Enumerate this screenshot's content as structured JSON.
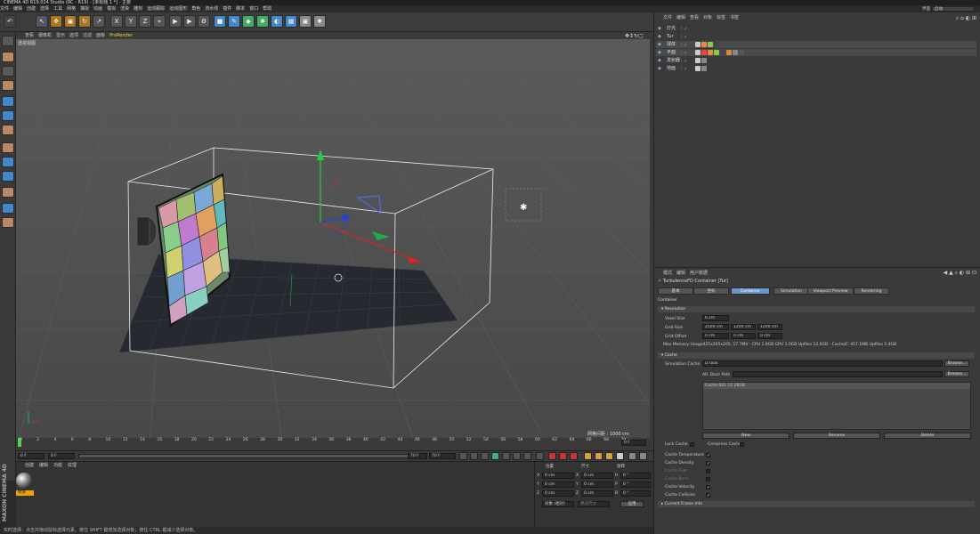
{
  "window": {
    "title": "CINEMA 4D R19.024 Studio (RC - R19) - [未标题 1 *] - 主要"
  },
  "menubar": [
    "文件",
    "编辑",
    "创建",
    "选择",
    "工具",
    "网格",
    "捕捉",
    "动画",
    "模拟",
    "渲染",
    "雕刻",
    "运动跟踪",
    "运动图形",
    "角色",
    "流水线",
    "插件",
    "脚本",
    "窗口",
    "帮助"
  ],
  "toolbar": {
    "icons": [
      "undo-icon",
      "move-icon",
      "scale-icon",
      "rotate-icon",
      "select-icon",
      "x-axis-icon",
      "y-axis-icon",
      "z-axis-icon",
      "coord-icon",
      "render-view-icon",
      "render-icon",
      "render-settings-icon",
      "cube-icon",
      "pen-icon",
      "subdivision-icon",
      "cloner-icon",
      "deformer-icon",
      "floor-icon",
      "camera-icon",
      "light-icon"
    ],
    "xyz": [
      "X",
      "Y",
      "Z"
    ]
  },
  "viewport": {
    "menu": [
      "查看",
      "摄像机",
      "显示",
      "选项",
      "过滤",
      "面板",
      "ProRender"
    ],
    "label": "透视视图",
    "grid_scale_label": "网格间距 : 1000 cm"
  },
  "timeline": {
    "ticks": [
      "0",
      "2",
      "4",
      "6",
      "8",
      "10",
      "12",
      "14",
      "16",
      "18",
      "20",
      "22",
      "24",
      "26",
      "28",
      "30",
      "32",
      "34",
      "36",
      "38",
      "40",
      "42",
      "44",
      "46",
      "48",
      "50",
      "52",
      "54",
      "56",
      "58",
      "60",
      "62",
      "64",
      "66",
      "68",
      "70"
    ],
    "end_label": "0 F"
  },
  "transport": {
    "current": "0 F",
    "start": "0 F",
    "end": "70 F",
    "end2": "70 F"
  },
  "material": {
    "menu": [
      "创建",
      "编辑",
      "功能",
      "纹理"
    ],
    "name": "材质"
  },
  "coords": {
    "headers": [
      "位置",
      "尺寸",
      "旋转"
    ],
    "rows": [
      {
        "axis": "X",
        "pos": "0 cm",
        "size": "0 cm",
        "rot_label": "H",
        "rot": "0 °"
      },
      {
        "axis": "Y",
        "pos": "0 cm",
        "size": "0 cm",
        "rot_label": "P",
        "rot": "0 °"
      },
      {
        "axis": "Z",
        "pos": "0 cm",
        "size": "0 cm",
        "rot_label": "B",
        "rot": "0 °"
      }
    ],
    "mode": "对象 (相对)",
    "size_mode": "绝对尺寸",
    "apply": "应用"
  },
  "status": "实时选择：点击并拖动鼠标选择元素。按住 SHIFT 键增加选择对象；按住 CTRL 键减少选择对象。",
  "maxon": "MAXON CINEMA 4D",
  "right_top": {
    "layout_label": "界面",
    "layout_value": "启动"
  },
  "objects": {
    "menu": [
      "文件",
      "编辑",
      "查看",
      "对象",
      "标签",
      "书签"
    ],
    "rows": [
      {
        "name": "灯光",
        "tags": []
      },
      {
        "name": "Tur",
        "tags": []
      },
      {
        "name": "球体",
        "tags": [
          "#ccc",
          "#e84",
          "#8c4",
          "#444"
        ]
      },
      {
        "name": "平面",
        "tags": [
          "#ccc",
          "#e44",
          "#e84",
          "#8c4",
          "#444",
          "#c84",
          "#888",
          "#555"
        ]
      },
      {
        "name": "发射器",
        "tags": [
          "#ccc",
          "#888"
        ]
      },
      {
        "name": "地面",
        "tags": [
          "#ccc",
          "#888"
        ]
      }
    ]
  },
  "attributes": {
    "menu": [
      "模式",
      "编辑",
      "用户数据"
    ],
    "object_title": "TurbulenceFD Container [Tur]",
    "tabs": [
      "基本",
      "坐标",
      "Container",
      "Simulation",
      "Viewport Preview",
      "Rendering"
    ],
    "active_tab": "Container",
    "section_title": "Container",
    "resolution": {
      "header": "Resolution",
      "voxel_label": "Voxel Size",
      "voxel": "6 cm",
      "grid_size_label": "Grid Size",
      "grid_size": [
        "2500 cm",
        "1200 cm",
        "1200 cm"
      ],
      "grid_offset_label": "Grid Offset",
      "grid_offset": [
        "0 cm",
        "0 cm",
        "0 cm"
      ],
      "memory": "Max Memory Usage425x205x205, 17.7MV - CPU 1.9GB GPU 1.0GB Upfiles 12.6GB - Cache/F: 457.1MB Upfiles 5.4GB"
    },
    "cache": {
      "header": "Cache",
      "sim_label": "Simulation Cache",
      "sim_path": "D:\\ook",
      "alt_label": "Alt. Base Path",
      "alt_path": "",
      "browse": "Browse...",
      "list_item": "Cache 001 12.26GB",
      "new": "New",
      "rename": "Rename",
      "delete": "Delete",
      "lock_label": "Lock Cache",
      "compress_label": "Compress Cache",
      "channels": [
        {
          "label": "Cache Temperature",
          "checked": true
        },
        {
          "label": "Cache Density",
          "checked": true
        },
        {
          "label": "Cache Fuel",
          "checked": false
        },
        {
          "label": "Cache Burn",
          "checked": false
        },
        {
          "label": "Cache Velocity",
          "checked": true
        },
        {
          "label": "Cache Collision",
          "checked": true
        }
      ],
      "current_frame": "Current Frame Info"
    }
  }
}
